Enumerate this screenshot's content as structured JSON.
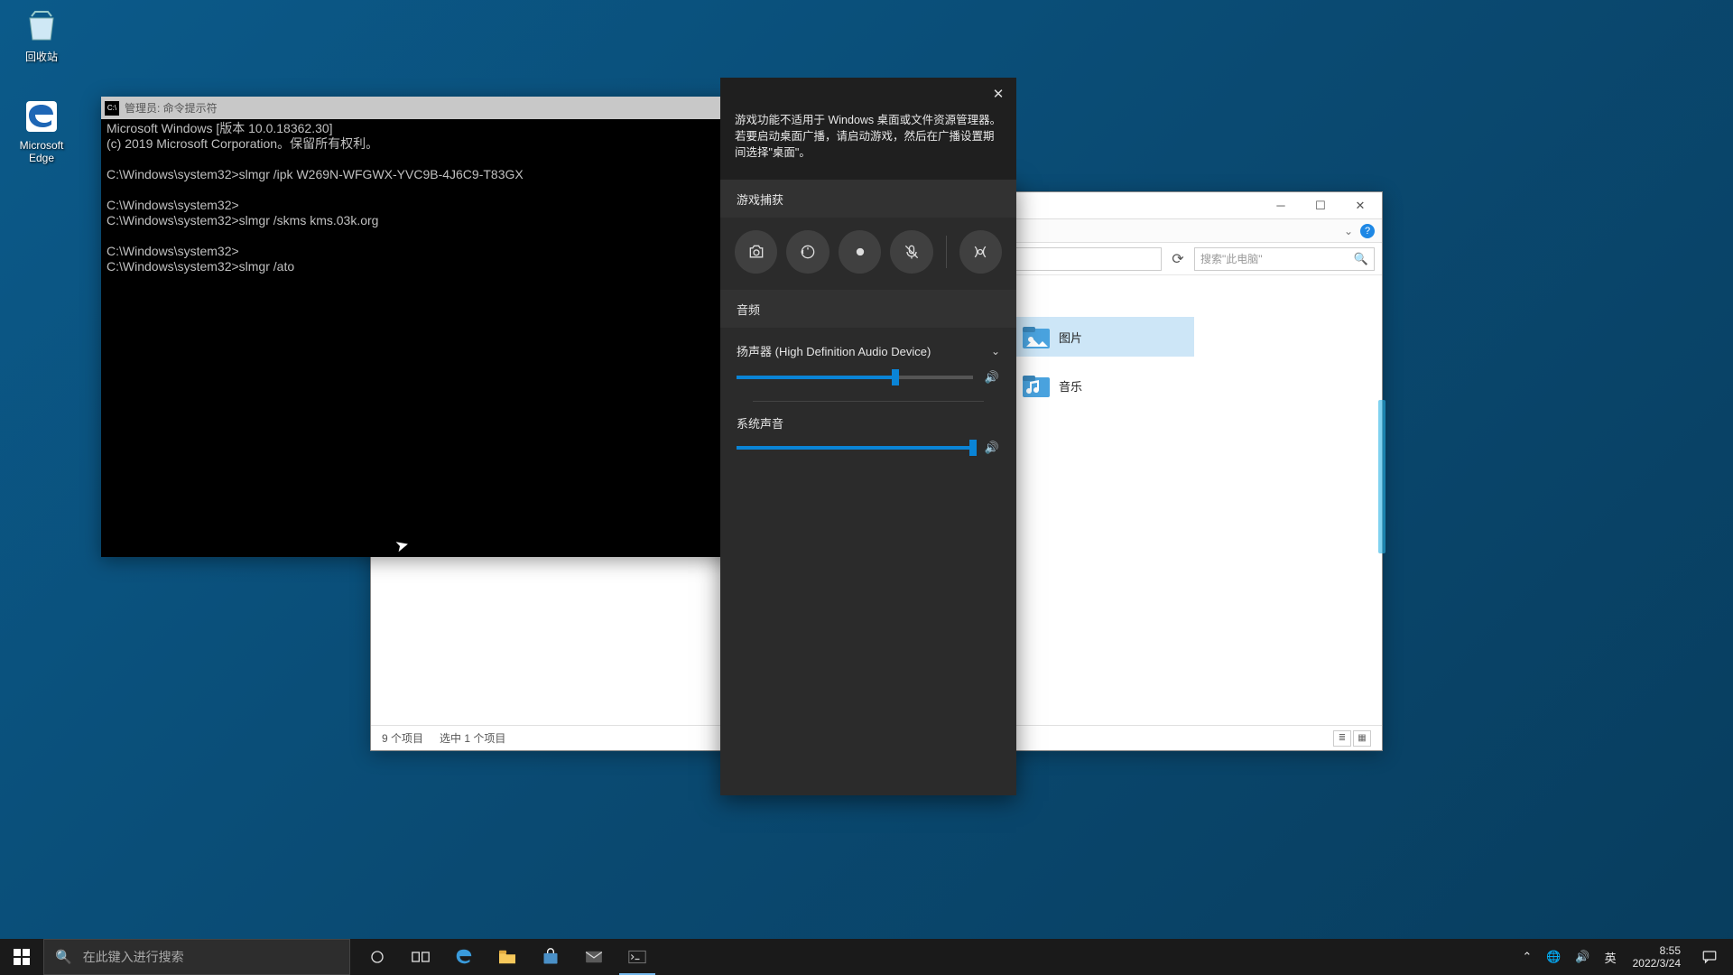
{
  "desktop": {
    "recycle_bin": "回收站",
    "edge": "Microsoft Edge"
  },
  "cmd": {
    "title": "管理员: 命令提示符",
    "lines": [
      "Microsoft Windows [版本 10.0.18362.30]",
      "(c) 2019 Microsoft Corporation。保留所有权利。",
      "",
      "C:\\Windows\\system32>slmgr /ipk W269N-WFGWX-YVC9B-4J6C9-T83GX",
      "",
      "C:\\Windows\\system32>",
      "C:\\Windows\\system32>slmgr /skms kms.03k.org",
      "",
      "C:\\Windows\\system32>",
      "C:\\Windows\\system32>slmgr /ato"
    ]
  },
  "explorer": {
    "search_placeholder": "搜索\"此电脑\"",
    "items": {
      "pictures": "图片",
      "music": "音乐"
    },
    "status_count": "9 个项目",
    "status_selected": "选中 1 个项目"
  },
  "gamebar": {
    "close_aria": "关闭",
    "notice": "游戏功能不适用于 Windows 桌面或文件资源管理器。若要启动桌面广播，请启动游戏，然后在广播设置期间选择\"桌面\"。",
    "capture_title": "游戏捕获",
    "audio_title": "音频",
    "device_label": "扬声器 (High Definition Audio Device)",
    "system_audio_label": "系统声音",
    "slider1_pct": 67,
    "slider2_pct": 100
  },
  "taskbar": {
    "search_placeholder": "在此键入进行搜索",
    "ime": "英",
    "time": "8:55",
    "date": "2022/3/24"
  }
}
